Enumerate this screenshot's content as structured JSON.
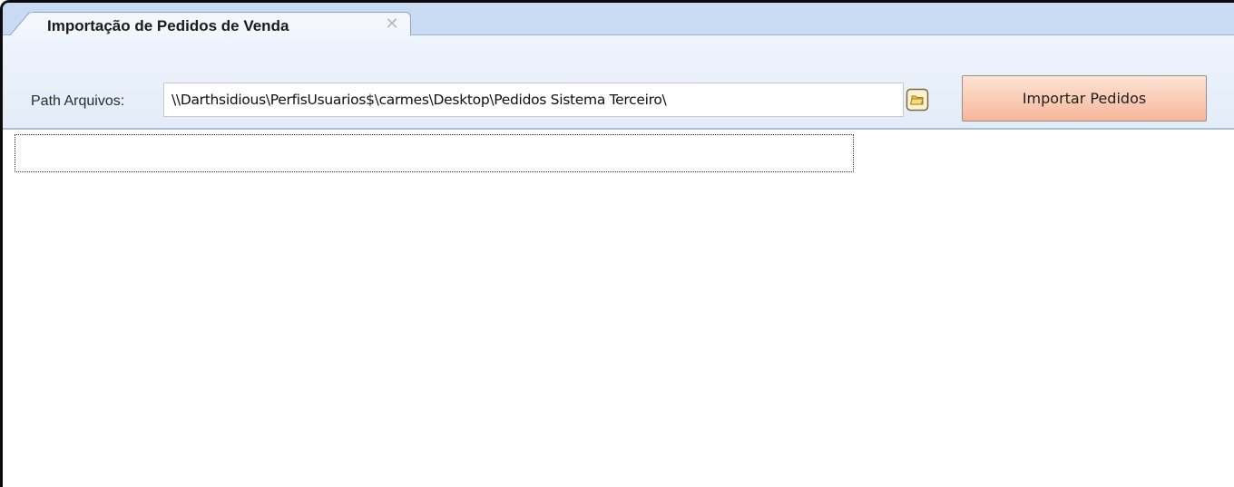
{
  "tab": {
    "title": "Importação de Pedidos de Venda",
    "close_glyph": "✕"
  },
  "toolbar": {
    "path_label": "Path Arquivos:",
    "path_value": "\\\\Darthsidious\\PerfisUsuarios$\\carmes\\Desktop\\Pedidos Sistema Terceiro\\",
    "browse_icon": "folder-icon",
    "import_button_label": "Importar Pedidos"
  },
  "colors": {
    "tabstrip": "#c9daf3",
    "toolbar": "#e8f0fa",
    "import_button": "#f6b79a",
    "folder_icon": "#f2c94c"
  }
}
